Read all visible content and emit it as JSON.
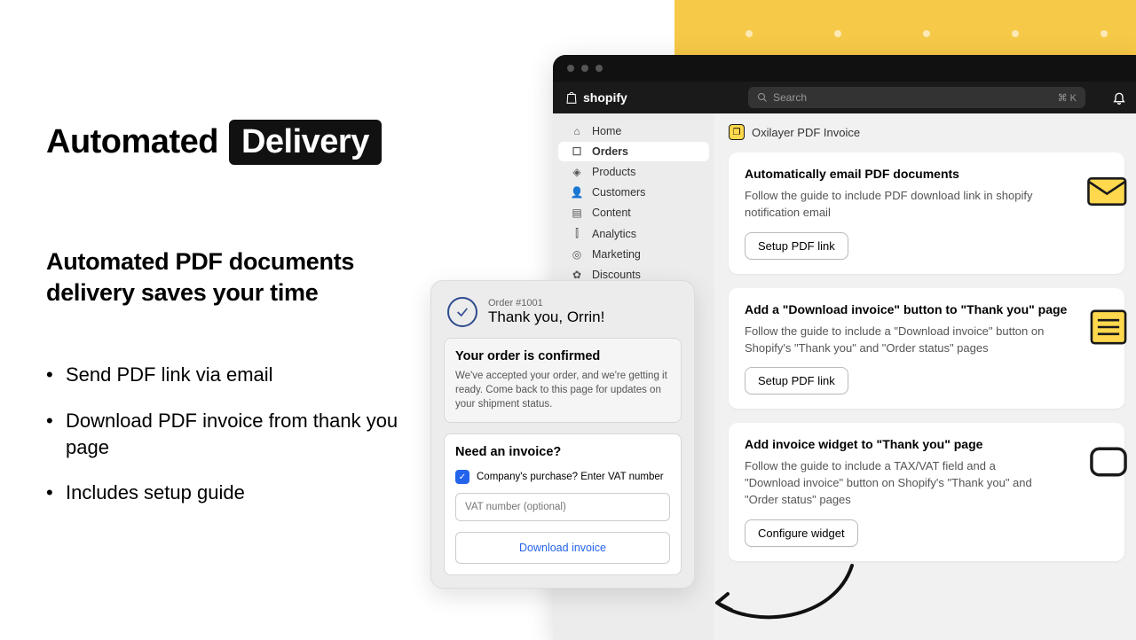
{
  "headline": {
    "word1": "Automated",
    "word2": "Delivery"
  },
  "subhead": "Automated PDF documents delivery saves your time",
  "bullets": [
    "Send PDF link via email",
    "Download PDF invoice from thank you page",
    "Includes setup guide"
  ],
  "header": {
    "brand": "shopify",
    "search_placeholder": "Search",
    "shortcut": "⌘ K"
  },
  "sidebar": {
    "items": [
      {
        "label": "Home",
        "icon": "home"
      },
      {
        "label": "Orders",
        "icon": "orders",
        "active": true
      },
      {
        "label": "Products",
        "icon": "products"
      },
      {
        "label": "Customers",
        "icon": "customers"
      },
      {
        "label": "Content",
        "icon": "content"
      },
      {
        "label": "Analytics",
        "icon": "analytics"
      },
      {
        "label": "Marketing",
        "icon": "marketing"
      },
      {
        "label": "Discounts",
        "icon": "discounts"
      }
    ]
  },
  "page": {
    "title": "Oxilayer PDF Invoice"
  },
  "cards": [
    {
      "title": "Automatically email PDF documents",
      "body": "Follow the guide to include PDF download link in shopify notification email",
      "button": "Setup PDF link"
    },
    {
      "title": "Add a \"Download invoice\" button to \"Thank you\" page",
      "body": "Follow the guide to include a \"Download invoice\" button on Shopify's \"Thank you\" and \"Order status\" pages",
      "button": "Setup PDF link"
    },
    {
      "title": "Add invoice widget to \"Thank you\" page",
      "body": "Follow the guide to include a TAX/VAT field and a \"Download invoice\" button on Shopify's \"Thank you\" and \"Order status\" pages",
      "button": "Configure widget"
    }
  ],
  "order": {
    "number": "Order #1001",
    "thanks": "Thank you, Orrin!",
    "confirmed_title": "Your order is confirmed",
    "confirmed_body": "We've accepted your order, and we're getting it ready. Come back to this page for updates on your shipment status.",
    "invoice_title": "Need an invoice?",
    "checkbox_label": "Company's purchase? Enter VAT number",
    "vat_placeholder": "VAT number (optional)",
    "download_label": "Download invoice"
  }
}
